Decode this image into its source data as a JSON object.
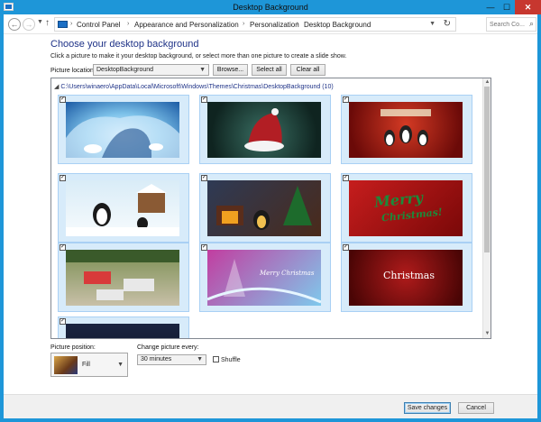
{
  "window": {
    "title": "Desktop Background",
    "minimize_glyph": "—",
    "maximize_glyph": "☐",
    "close_glyph": "✕"
  },
  "address": {
    "crumbs": [
      "Control Panel",
      "Appearance and Personalization",
      "Personalization",
      "Desktop Background"
    ],
    "separator": "›",
    "search_placeholder": "Search Co..."
  },
  "content": {
    "heading": "Choose your desktop background",
    "subtext": "Click a picture to make it your desktop background, or select more than one picture to create a slide show.",
    "picture_location_label": "Picture location:",
    "picture_location_value": "DesktopBackground",
    "browse_label": "Browse...",
    "select_all_label": "Select all",
    "clear_all_label": "Clear all"
  },
  "gallery": {
    "group_path": "C:\\Users\\winaero\\AppData\\Local\\Microsoft\\Windows\\Themes\\Christmas\\DesktopBackground (10)",
    "tiles": [
      {
        "name": "tux-ice-cave",
        "checked": true
      },
      {
        "name": "santa-hat",
        "checked": true
      },
      {
        "name": "penguins-red",
        "checked": true
      },
      {
        "name": "tux-snowman",
        "checked": true
      },
      {
        "name": "tux-fireplace",
        "checked": true
      },
      {
        "name": "merry-christmas-red",
        "checked": true
      },
      {
        "name": "tux-office-party",
        "checked": true
      },
      {
        "name": "merry-christmas-pink",
        "checked": true
      },
      {
        "name": "christmas-dark-red",
        "checked": true
      },
      {
        "name": "partial-tile",
        "checked": true
      }
    ],
    "thumb_texts": {
      "merry": "Merry",
      "christmas": "Christmas!",
      "pink_text": "Merry Christmas",
      "dark_text": "Christmas"
    }
  },
  "bottom": {
    "position_label": "Picture position:",
    "position_value": "Fill",
    "change_label": "Change picture every:",
    "interval_value": "30 minutes",
    "shuffle_label": "Shuffle"
  },
  "footer": {
    "save_label": "Save changes",
    "cancel_label": "Cancel"
  }
}
